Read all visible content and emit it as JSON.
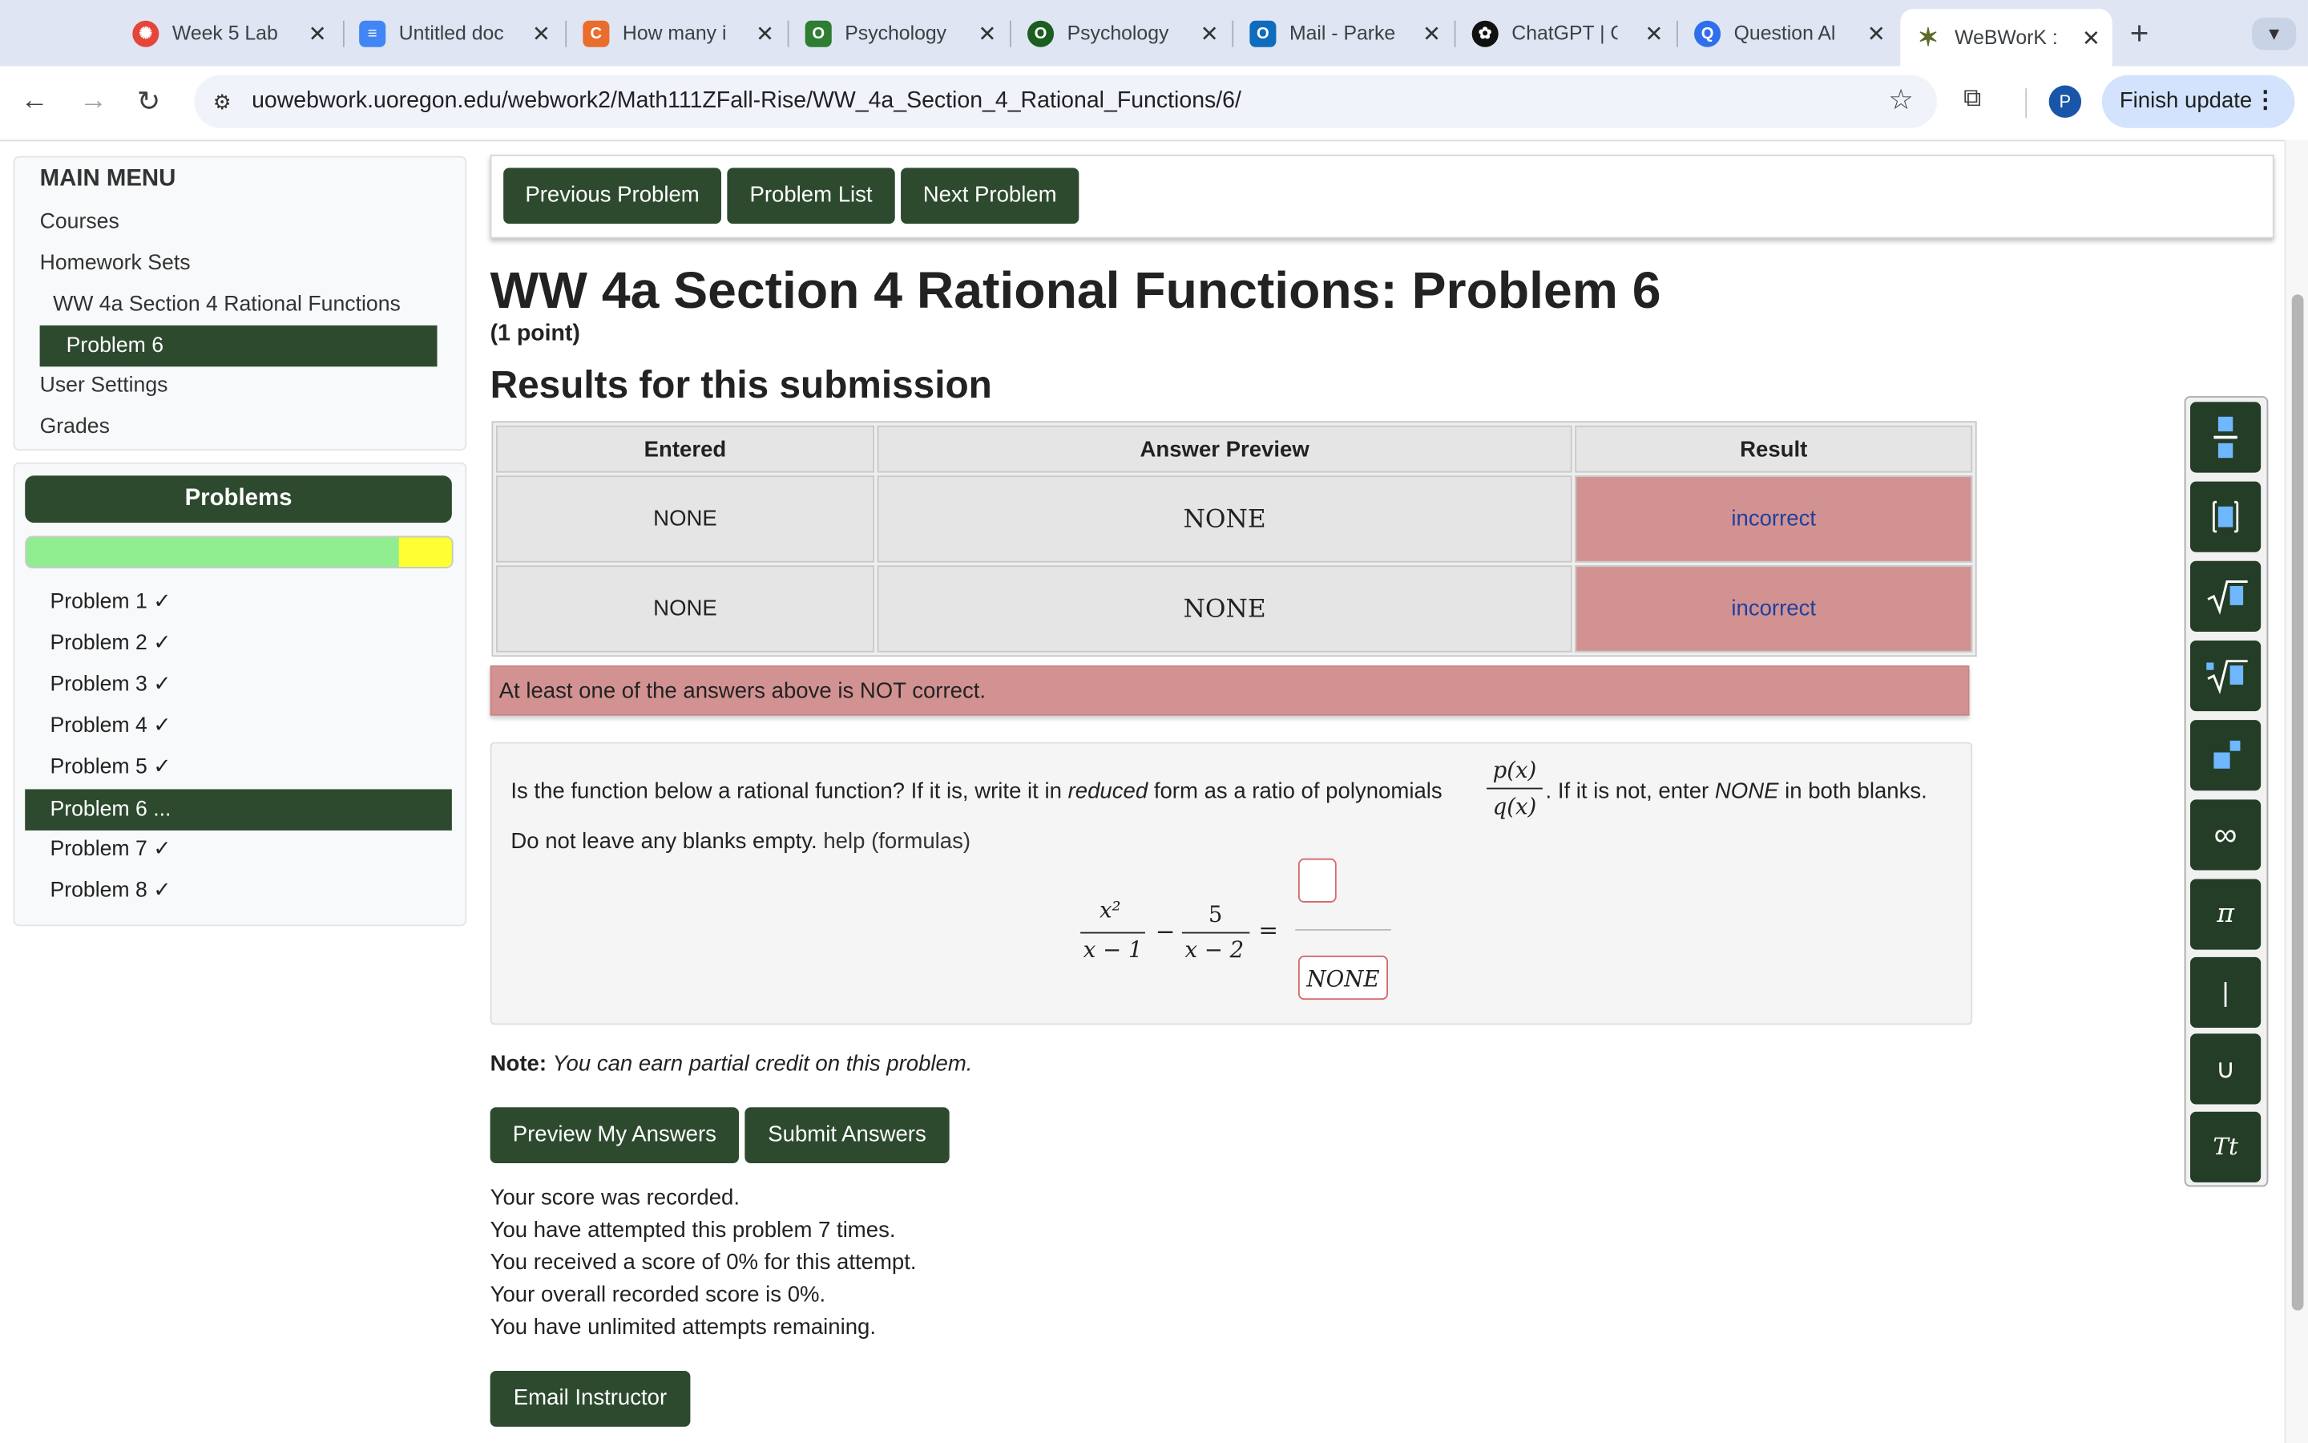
{
  "tabs": [
    {
      "title": "Week 5 Lab",
      "icon": "canvas-icon",
      "color": "#e4463a"
    },
    {
      "title": "Untitled doc",
      "icon": "google-docs-icon",
      "color": "#4285f4"
    },
    {
      "title": "How many i",
      "icon": "chegg-icon",
      "color": "#e96d2c"
    },
    {
      "title": "Psychology",
      "icon": "quizlet-icon",
      "color": "#2e7d32"
    },
    {
      "title": "Psychology",
      "icon": "quizlet-icon",
      "color": "#1b5e20"
    },
    {
      "title": "Mail - Parke",
      "icon": "outlook-icon",
      "color": "#0f6cbd"
    },
    {
      "title": "ChatGPT | C",
      "icon": "chatgpt-icon",
      "color": "#111111"
    },
    {
      "title": "Question Al",
      "icon": "question-ai-icon",
      "color": "#2f6fed"
    },
    {
      "title": "WeBWorK :",
      "icon": "webwork-icon",
      "color": "#5c6b2d"
    }
  ],
  "toolbar": {
    "url": "uowebwork.uoregon.edu/webwork2/Math111ZFall-Rise/WW_4a_Section_4_Rational_Functions/6/",
    "avatar_letter": "P",
    "finish_update": "Finish update"
  },
  "sidebar": {
    "menu_title": "MAIN MENU",
    "links": [
      "Courses",
      "Homework Sets",
      "WW 4a Section 4 Rational Functions"
    ],
    "active_link": "Problem 6",
    "links_after": [
      "User Settings",
      "Grades"
    ],
    "problems_title": "Problems",
    "progress_correct_fraction": 0.875,
    "problems": [
      "Problem 1 ✓",
      "Problem 2 ✓",
      "Problem 3 ✓",
      "Problem 4 ✓",
      "Problem 5 ✓",
      "Problem 6 ...",
      "Problem 7 ✓",
      "Problem 8 ✓"
    ]
  },
  "nav_buttons": {
    "previous": "Previous Problem",
    "list": "Problem List",
    "next": "Next Problem"
  },
  "page": {
    "title": "WW 4a Section 4 Rational Functions: Problem 6",
    "points": "(1 point)",
    "results_heading": "Results for this submission"
  },
  "results": {
    "headers": [
      "Entered",
      "Answer Preview",
      "Result"
    ],
    "rows": [
      {
        "entered": "NONE",
        "preview": "NONE",
        "result": "incorrect"
      },
      {
        "entered": "NONE",
        "preview": "NONE",
        "result": "incorrect"
      }
    ]
  },
  "alert": "At least one of the answers above is NOT correct.",
  "question": {
    "text_a": "Is the function below a rational function? If it is, write it in ",
    "text_em": "reduced",
    "text_b": " form as a ratio of polynomials",
    "pq_num": "p(x)",
    "pq_den": "q(x)",
    "text_c": ". If it is not, enter ",
    "text_em2": "NONE",
    "text_d": " in both blanks.",
    "line2": "Do not leave any blanks empty. ",
    "help_link": "help (formulas)",
    "eq_num1": "x²",
    "eq_den1": "x − 1",
    "eq_minus": "−",
    "eq_num2": "5",
    "eq_den2": "x − 2",
    "eq_equals": "=",
    "answer_top": "",
    "answer_bottom": "NONE"
  },
  "note": {
    "label": "Note:",
    "text": "You can earn partial credit on this problem."
  },
  "submit": {
    "preview": "Preview My Answers",
    "submit": "Submit Answers"
  },
  "status_lines": [
    "Your score was recorded.",
    "You have attempted this problem 7 times.",
    "You received a score of 0% for this attempt.",
    "Your overall recorded score is 0%.",
    "You have unlimited attempts remaining."
  ],
  "email_button": "Email Instructor",
  "math_toolbar": [
    "fraction-icon",
    "bracket-icon",
    "sqrt-icon",
    "nth-root-icon",
    "exponent-icon",
    "∞",
    "π",
    "|",
    "∪",
    "Tt"
  ]
}
